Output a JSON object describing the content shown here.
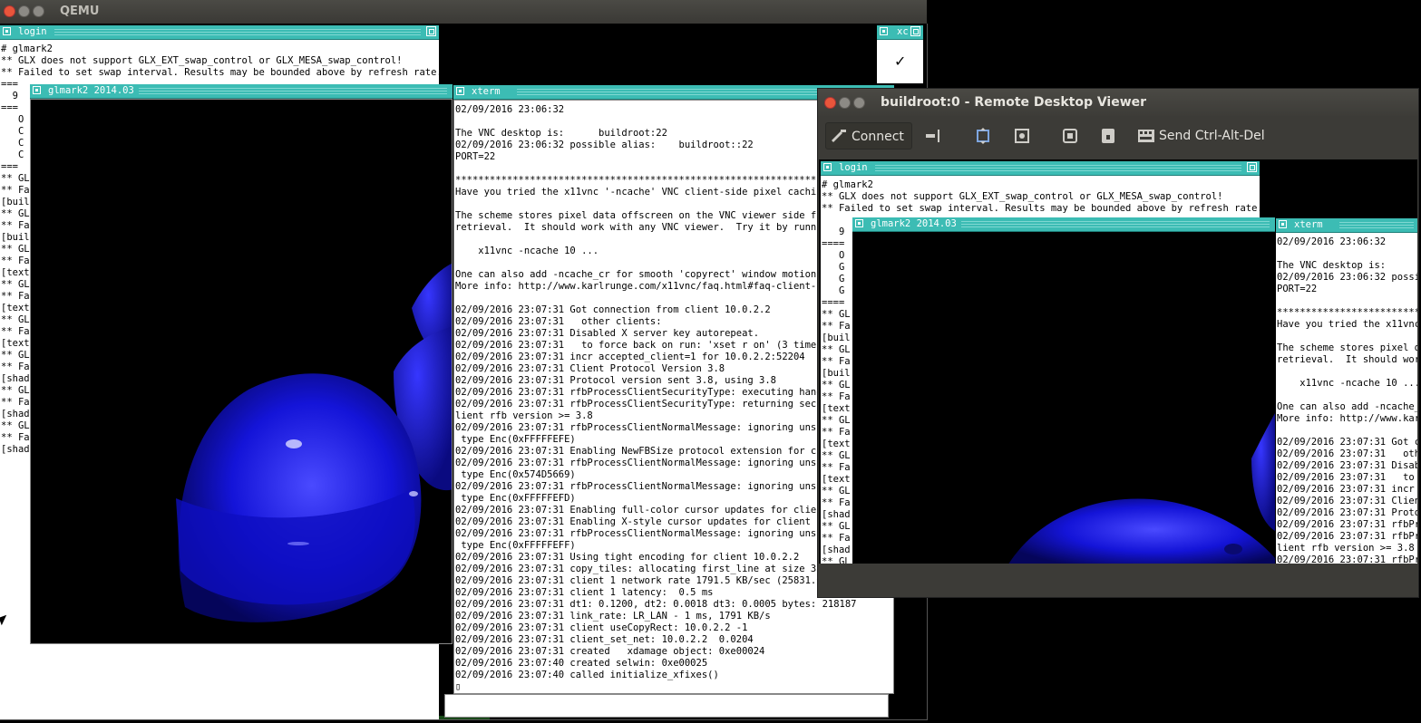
{
  "qemu": {
    "title": "QEMU"
  },
  "login_window": {
    "title": "login",
    "lines": [
      "# glmark2",
      "** GLX does not support GLX_EXT_swap_control or GLX_MESA_swap_control!",
      "** Failed to set swap interval. Results may be bounded above by refresh rate.",
      "==="
    ],
    "left_fragments": [
      "  9",
      "===",
      "   O",
      "   C",
      "   C",
      "   C",
      "===",
      "** GL",
      "** Fa",
      "[buil",
      "** GL",
      "** Fa",
      "[buil",
      "** GL",
      "** Fa",
      "[text",
      "** GL",
      "** Fa",
      "[text",
      "** GL",
      "** Fa",
      "[text",
      "** GL",
      "** Fa",
      "[shad",
      "** GL",
      "** Fa",
      "[shad",
      "** GL",
      "** Fa",
      "[shad"
    ]
  },
  "xc_window": {
    "title": "xc",
    "check": "✓"
  },
  "glmark_window": {
    "title": "glmark2 2014.03"
  },
  "xterm_window": {
    "title": "xterm",
    "lines": [
      "02/09/2016 23:06:32",
      "",
      "The VNC desktop is:      buildroot:22",
      "02/09/2016 23:06:32 possible alias:    buildroot::22",
      "PORT=22",
      "",
      "******************************************************************************",
      "Have you tried the x11vnc '-ncache' VNC client-side pixel caching",
      "",
      "The scheme stores pixel data offscreen on the VNC viewer side for",
      "retrieval.  It should work with any VNC viewer.  Try it by running",
      "",
      "    x11vnc -ncache 10 ...",
      "",
      "One can also add -ncache_cr for smooth 'copyrect' window motion.",
      "More info: http://www.karlrunge.com/x11vnc/faq.html#faq-client-cach",
      "",
      "02/09/2016 23:07:31 Got connection from client 10.0.2.2",
      "02/09/2016 23:07:31   other clients:",
      "02/09/2016 23:07:31 Disabled X server key autorepeat.",
      "02/09/2016 23:07:31   to force back on run: 'xset r on' (3 times)",
      "02/09/2016 23:07:31 incr accepted_client=1 for 10.0.2.2:52204  sock",
      "02/09/2016 23:07:31 Client Protocol Version 3.8",
      "02/09/2016 23:07:31 Protocol version sent 3.8, using 3.8",
      "02/09/2016 23:07:31 rfbProcessClientSecurityType: executing handler",
      "02/09/2016 23:07:31 rfbProcessClientSecurityType: returning securi",
      "lient rfb version >= 3.8",
      "02/09/2016 23:07:31 rfbProcessClientNormalMessage: ignoring unsuppo",
      " type Enc(0xFFFFFEFE)",
      "02/09/2016 23:07:31 Enabling NewFBSize protocol extension for clie",
      "02/09/2016 23:07:31 rfbProcessClientNormalMessage: ignoring unsuppo",
      " type Enc(0x574D5669)",
      "02/09/2016 23:07:31 rfbProcessClientNormalMessage: ignoring unsuppo",
      " type Enc(0xFFFFFEFD)",
      "02/09/2016 23:07:31 Enabling full-color cursor updates for client",
      "02/09/2016 23:07:31 Enabling X-style cursor updates for client 10.0",
      "02/09/2016 23:07:31 rfbProcessClientNormalMessage: ignoring unsuppo",
      " type Enc(0xFFFFFEFF)",
      "02/09/2016 23:07:31 Using tight encoding for client 10.0.2.2",
      "02/09/2016 23:07:31 copy_tiles: allocating first_line at size 33",
      "02/09/2016 23:07:31 client 1 network rate 1791.5 KB/sec (25831.0 e",
      "02/09/2016 23:07:31 client 1 latency:  0.5 ms",
      "02/09/2016 23:07:31 dt1: 0.1200, dt2: 0.0018 dt3: 0.0005 bytes: 218187",
      "02/09/2016 23:07:31 link_rate: LR_LAN - 1 ms, 1791 KB/s",
      "02/09/2016 23:07:31 client useCopyRect: 10.0.2.2 -1",
      "02/09/2016 23:07:31 client_set_net: 10.0.2.2  0.0204",
      "02/09/2016 23:07:31 created   xdamage object: 0xe00024",
      "02/09/2016 23:07:40 created selwin: 0xe00025",
      "02/09/2016 23:07:40 called initialize_xfixes()",
      "▯"
    ]
  },
  "rdv": {
    "title": "buildroot:0 - Remote Desktop Viewer",
    "connect_label": "Connect",
    "ctrl_alt_del_label": "Send Ctrl-Alt-Del",
    "icons": [
      "connect-icon",
      "disconnect-icon",
      "fit-window-icon",
      "screenshot-icon",
      "scaling-icon",
      "lock-icon",
      "keyboard-icon"
    ]
  },
  "inner": {
    "login_title": "login",
    "login_lines": [
      "# glmark2",
      "** GLX does not support GLX_EXT_swap_control or GLX_MESA_swap_control!",
      "** Failed to set swap interval. Results may be bounded above by refresh rate."
    ],
    "left_fragments": [
      "   9",
      "====",
      "   O",
      "   G",
      "   G",
      "   G",
      "====",
      "** GL",
      "** Fa",
      "[buil",
      "** GL",
      "** Fa",
      "[buil",
      "** GL",
      "** Fa",
      "[text",
      "** GL",
      "** Fa",
      "[text",
      "** GL",
      "** Fa",
      "[text",
      "** GL",
      "** Fa",
      "[shad",
      "** GL",
      "** Fa",
      "[shad",
      "** GL"
    ],
    "glmark_title": "glmark2 2014.03",
    "xterm_title": "xterm",
    "xterm_lines": [
      "02/09/2016 23:06:32",
      "",
      "The VNC desktop is:      b",
      "02/09/2016 23:06:32 possib",
      "PORT=22",
      "",
      "********************************",
      "Have you tried the x11vnc",
      "",
      "The scheme stores pixel da",
      "retrieval.  It should work",
      "",
      "    x11vnc -ncache 10 ...",
      "",
      "One can also add -ncache_c",
      "More info: http://www.karl",
      "",
      "02/09/2016 23:07:31 Got co",
      "02/09/2016 23:07:31   othe",
      "02/09/2016 23:07:31 Disabl",
      "02/09/2016 23:07:31   to f",
      "02/09/2016 23:07:31 incr a",
      "02/09/2016 23:07:31 Client",
      "02/09/2016 23:07:31 Protoc",
      "02/09/2016 23:07:31 rfbPro",
      "02/09/2016 23:07:31 rfbPro",
      "lient rfb version >= 3.8",
      "02/09/2016 23:07:31 rfbPro"
    ]
  },
  "colors": {
    "twm_title": "#3cbcb4",
    "object_blue": "#1414d8"
  }
}
